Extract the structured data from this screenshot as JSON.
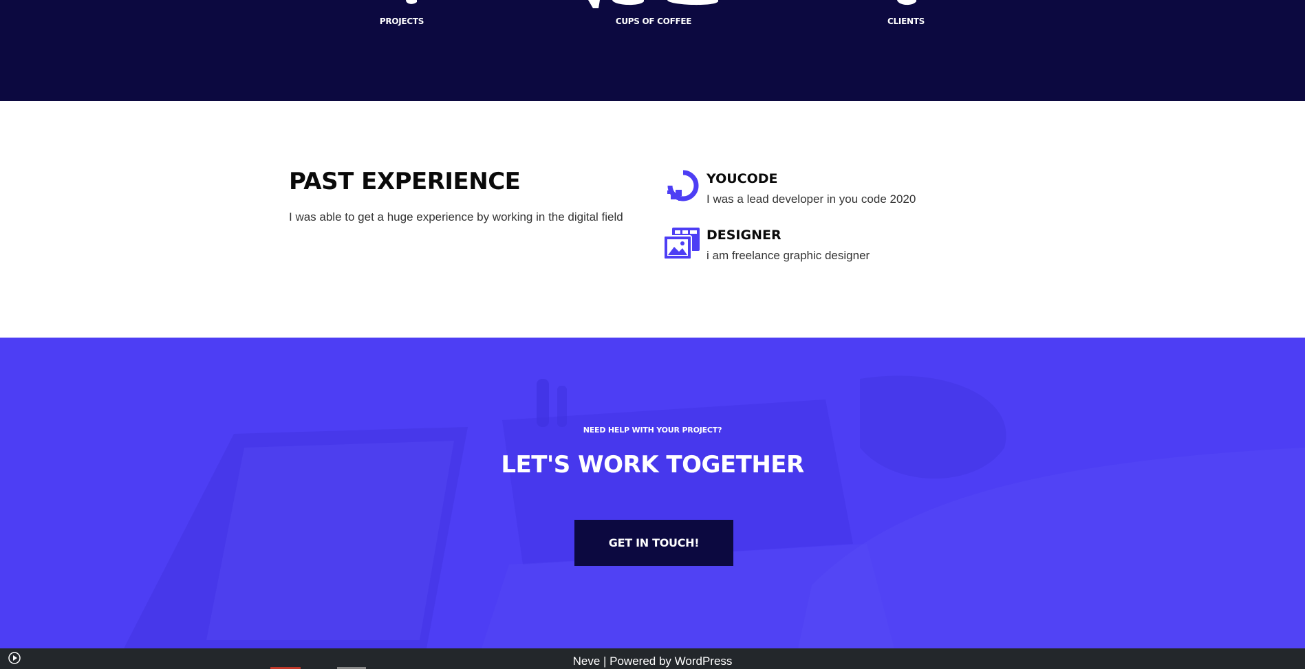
{
  "stats": {
    "items": [
      {
        "label": "PROJECTS",
        "number_partial": ""
      },
      {
        "label": "CUPS OF COFFEE",
        "number_partial": ""
      },
      {
        "label": "CLIENTS",
        "number_partial": ""
      }
    ]
  },
  "experience": {
    "title": "PAST EXPERIENCE",
    "description": "I was able to get a huge experience by working in the digital field",
    "items": [
      {
        "icon": "spinner-logo-icon",
        "name": "YOUCODE",
        "text": "I was a lead developer in you code 2020"
      },
      {
        "icon": "image-gallery-icon",
        "name": "DESIGNER",
        "text": "i am freelance graphic designer"
      }
    ]
  },
  "cta": {
    "eyebrow": "NEED HELP WITH YOUR PROJECT?",
    "headline": "LET'S WORK TOGETHER",
    "button_label": "GET IN TOUCH!"
  },
  "footer": {
    "theme": "Neve",
    "separator": " | Powered by ",
    "platform": "WordPress"
  },
  "colors": {
    "dark_navy": "#0c0940",
    "accent_purple": "#4d3ef4",
    "footer_bg": "#23272b"
  }
}
